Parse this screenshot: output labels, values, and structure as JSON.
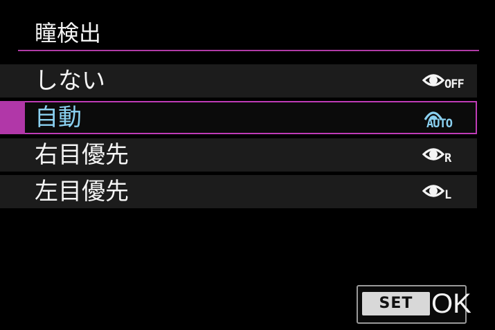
{
  "screen": {
    "title": "瞳検出"
  },
  "menu": {
    "items": [
      {
        "label": "しない",
        "icon": "eye-off-icon",
        "icon_tag": "OFF",
        "selected": false
      },
      {
        "label": "自動",
        "icon": "eye-auto-icon",
        "icon_tag": "AUTO",
        "selected": true
      },
      {
        "label": "右目優先",
        "icon": "eye-right-icon",
        "icon_tag": "R",
        "selected": false
      },
      {
        "label": "左目優先",
        "icon": "eye-left-icon",
        "icon_tag": "L",
        "selected": false
      }
    ]
  },
  "footer": {
    "set_label": "SET",
    "ok_label": "OK"
  },
  "colors": {
    "background": "#000000",
    "accent": "#b137a8",
    "selected_text": "#8ad0f0",
    "row_background": "#1c1c1c"
  }
}
